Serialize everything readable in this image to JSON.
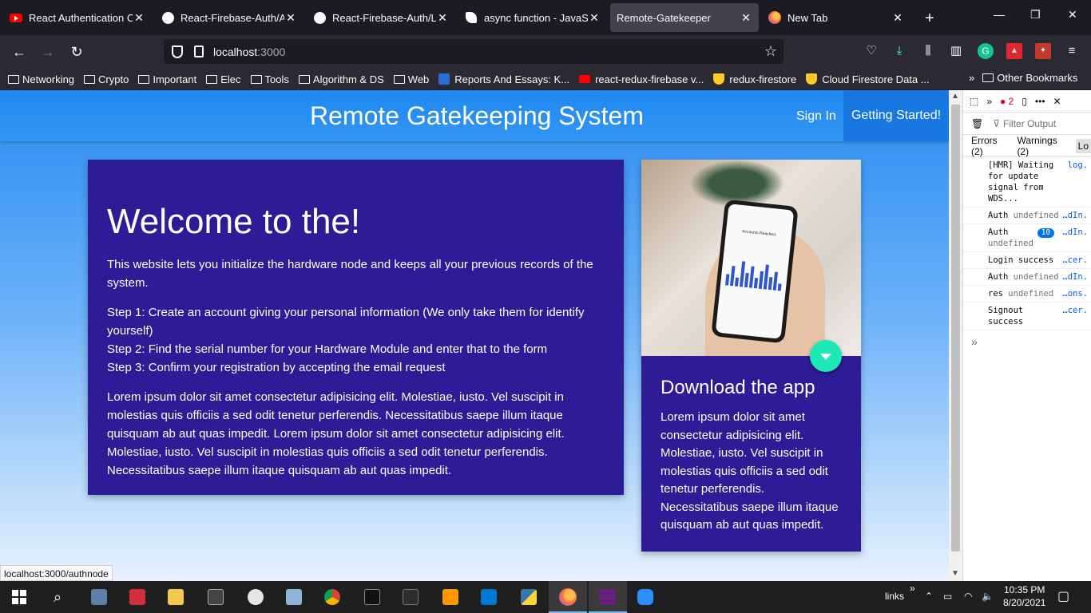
{
  "browser": {
    "tabs": [
      {
        "title": "React Authentication Cra",
        "icon": "youtube-icon",
        "active": false
      },
      {
        "title": "React-Firebase-Auth/Aut",
        "icon": "github-icon",
        "active": false
      },
      {
        "title": "React-Firebase-Auth/Log",
        "icon": "github-icon",
        "active": false
      },
      {
        "title": "async function - JavaScrip",
        "icon": "mdn-icon",
        "active": false
      },
      {
        "title": "Remote-Gatekeeper",
        "icon": "",
        "active": true
      },
      {
        "title": "New Tab",
        "icon": "firefox-icon",
        "active": false
      }
    ],
    "url_host": "localhost",
    "url_port": ":3000",
    "bookmarks": [
      {
        "label": "Networking",
        "icon": "folder-icon"
      },
      {
        "label": "Crypto",
        "icon": "folder-icon"
      },
      {
        "label": "Important",
        "icon": "folder-icon"
      },
      {
        "label": "Elec",
        "icon": "folder-icon"
      },
      {
        "label": "Tools",
        "icon": "folder-icon"
      },
      {
        "label": "Algorithm & DS",
        "icon": "folder-icon"
      },
      {
        "label": "Web",
        "icon": "folder-icon"
      },
      {
        "label": "Reports And Essays: K...",
        "icon": "bookmark-icon"
      },
      {
        "label": "react-redux-firebase v...",
        "icon": "youtube-icon"
      },
      {
        "label": "redux-firestore",
        "icon": "firebase-icon"
      },
      {
        "label": "Cloud Firestore Data ...",
        "icon": "firebase-icon"
      }
    ],
    "other_bookmarks": "Other Bookmarks",
    "status_link": "localhost:3000/authnode"
  },
  "app": {
    "brand": "Remote Gatekeeping System",
    "nav": {
      "signin": "Sign In",
      "getstarted": "Getting Started!"
    },
    "main_card": {
      "title": "Welcome to the!",
      "intro": "This website lets you initialize the hardware node and keeps all your previous records of the system.",
      "steps": [
        "Step 1: Create an account giving your personal information (We only take them for identify yourself)",
        "Step 2: Find the serial number for your Hardware Module and enter that to the form",
        "Step 3: Confirm your registration by accepting the email request"
      ],
      "lorem": "Lorem ipsum dolor sit amet consectetur adipisicing elit. Molestiae, iusto. Vel suscipit in molestias quis officiis a sed odit tenetur perferendis. Necessitatibus saepe illum itaque quisquam ab aut quas impedit. Lorem ipsum dolor sit amet consectetur adipisicing elit. Molestiae, iusto. Vel suscipit in molestias quis officiis a sed odit tenetur perferendis. Necessitatibus saepe illum itaque quisquam ab aut quas impedit."
    },
    "side_card": {
      "title": "Download the app",
      "text": "Lorem ipsum dolor sit amet consectetur adipisicing elit. Molestiae, iusto. Vel suscipit in molestias quis officiis a sed odit tenetur perferendis. Necessitatibus saepe illum itaque quisquam ab aut quas impedit.",
      "phone_screen_title": "Accounts Reached"
    }
  },
  "devtools": {
    "error_count": "2",
    "filter_placeholder": "Filter Output",
    "tabs": [
      "Errors (2)",
      "Warnings (2)",
      "Lo"
    ],
    "logs": [
      {
        "text": "[HMR] Waiting for update signal from WDS...",
        "src": "log."
      },
      {
        "text": "Auth",
        "extra": "undefined",
        "src": "…dIn."
      },
      {
        "text": "Auth",
        "badge": "10",
        "extra": "undefined",
        "src": "…dIn."
      },
      {
        "text": "Login success",
        "src": "…cer."
      },
      {
        "text": "Auth",
        "extra": "undefined",
        "src": "…dIn."
      },
      {
        "text": "res",
        "extra": "undefined",
        "src": "…ons."
      },
      {
        "text": "Signout success",
        "src": "…cer."
      }
    ]
  },
  "taskbar": {
    "tray_label": "links",
    "time": "10:35 PM",
    "date": "8/20/2021"
  }
}
